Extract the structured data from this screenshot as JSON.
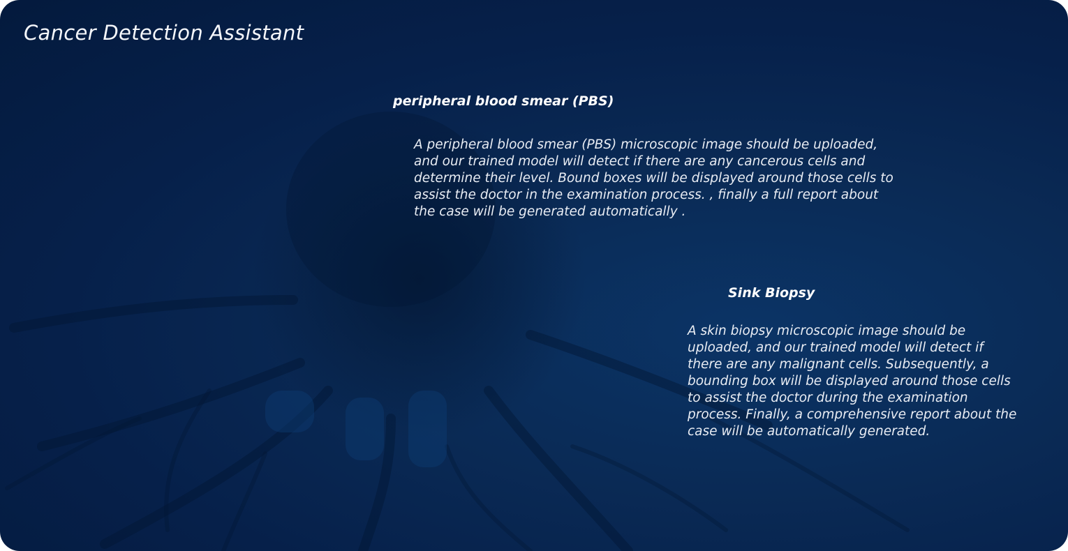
{
  "app": {
    "title": "Cancer Detection Assistant"
  },
  "sections": [
    {
      "title": "peripheral blood smear (PBS)",
      "description": "A peripheral blood smear (PBS) microscopic image should be uploaded, and our trained model will detect if there are any cancerous cells and determine their level. Bound boxes will be displayed around those cells to assist the doctor in the examination process. ,  finally a full report about the case will be generated automatically ."
    },
    {
      "title": "Sink Biopsy",
      "description": "A skin biopsy microscopic image should be uploaded, and our trained model will detect if there are any malignant cells. Subsequently, a bounding box will be displayed around those cells to assist the doctor during the examination process. Finally, a comprehensive report about the case will be automatically generated."
    }
  ],
  "theme": {
    "background": "#06204a",
    "text": "#f2f4f8"
  }
}
